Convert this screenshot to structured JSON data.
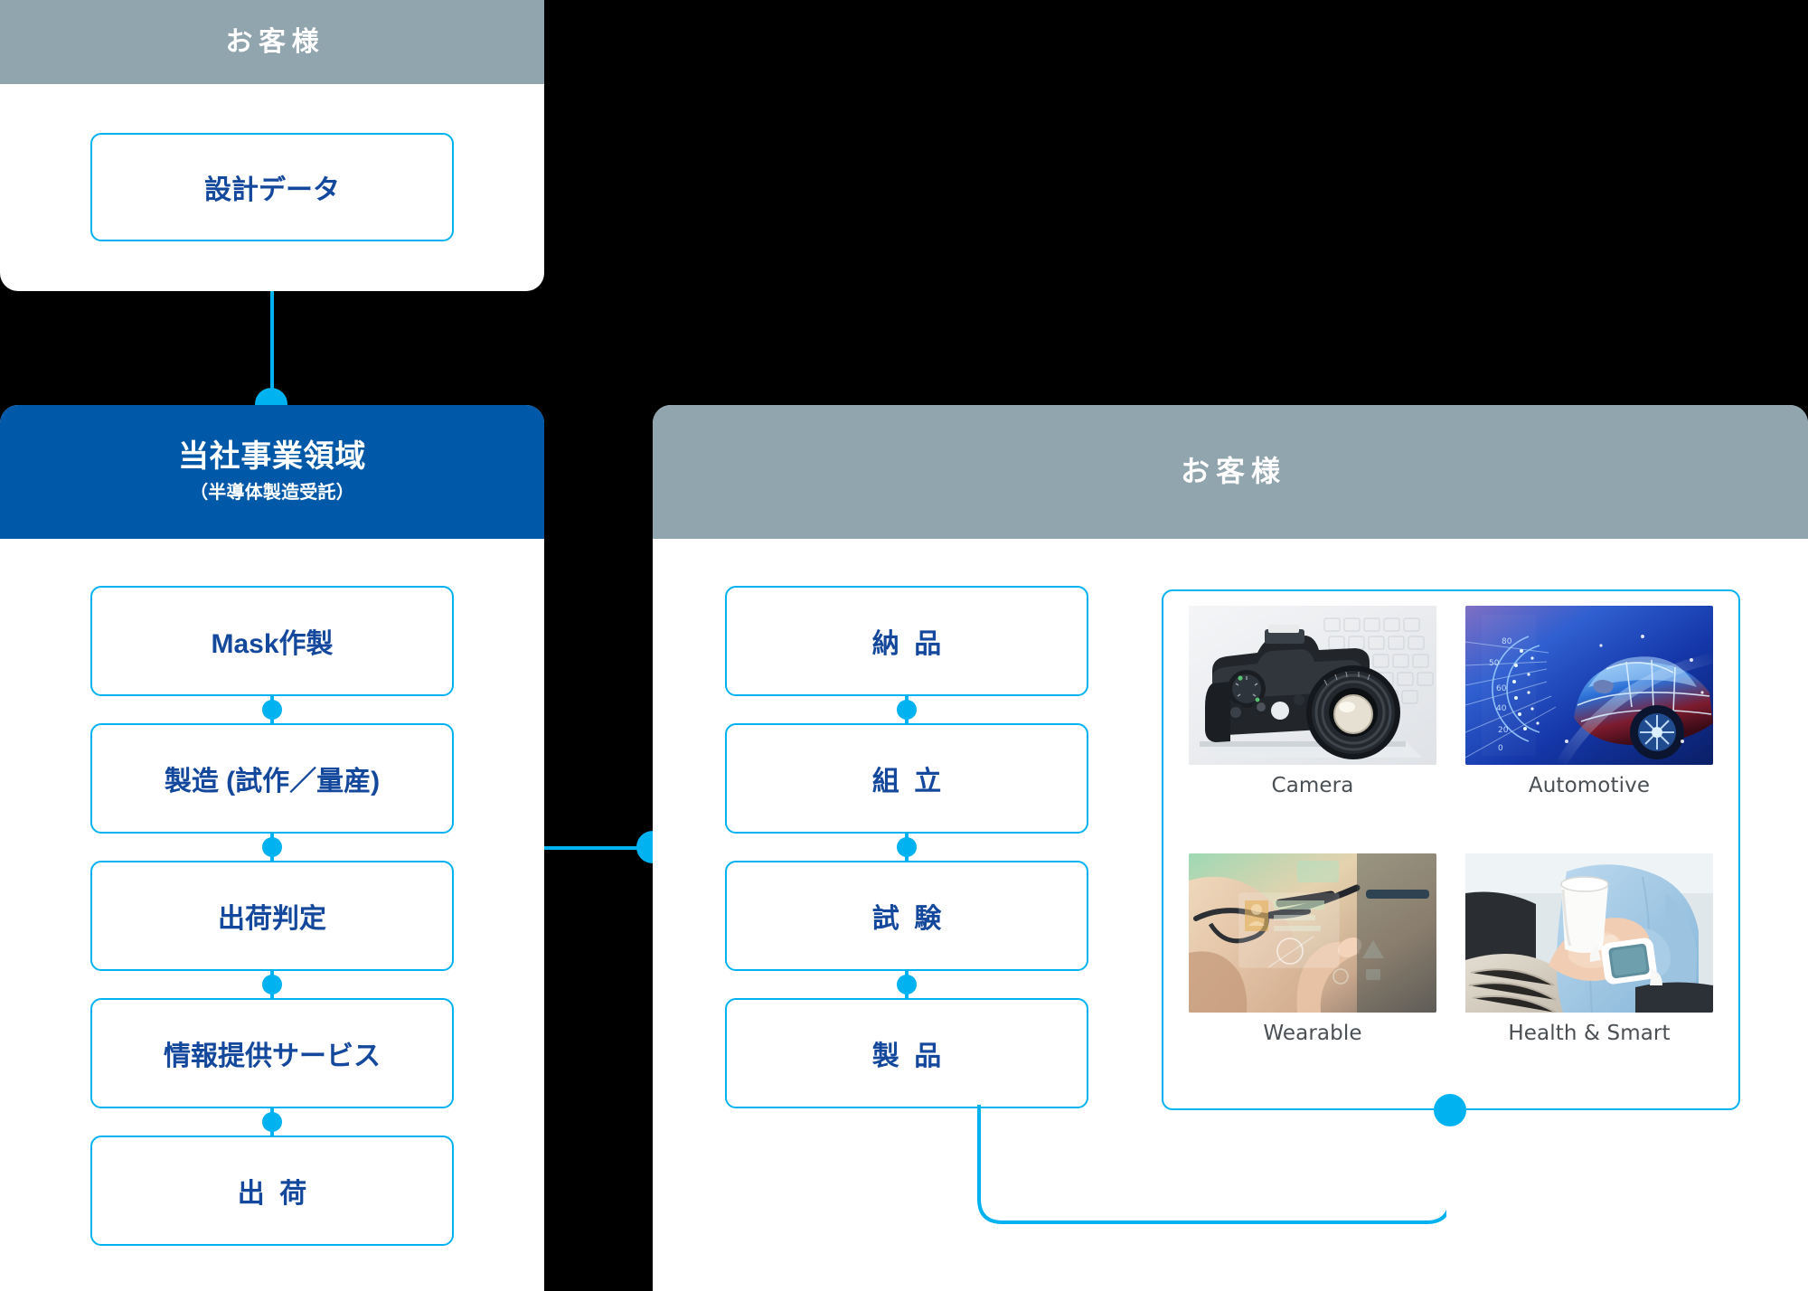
{
  "panels": {
    "customer_top": {
      "title": "お客様"
    },
    "business": {
      "title": "当社事業領域",
      "subtitle": "（半導体製造受託）"
    },
    "customer_right": {
      "title": "お客様"
    }
  },
  "customer_top_flow": [
    {
      "label": "設計データ"
    }
  ],
  "business_flow": [
    {
      "label": "Mask作製",
      "spaced": false
    },
    {
      "label": "製造 (試作／量産)",
      "spaced": false
    },
    {
      "label": "出荷判定",
      "spaced": false
    },
    {
      "label": "情報提供サービス",
      "spaced": false
    },
    {
      "label": "出荷",
      "spaced": true
    }
  ],
  "customer_flow": [
    {
      "label": "納品",
      "spaced": true
    },
    {
      "label": "組立",
      "spaced": true
    },
    {
      "label": "試験",
      "spaced": true
    },
    {
      "label": "製品",
      "spaced": true
    }
  ],
  "product_tiles": [
    {
      "label": "Camera",
      "icon": "camera-photo"
    },
    {
      "label": "Automotive",
      "icon": "automotive-photo"
    },
    {
      "label": "Wearable",
      "icon": "wearable-photo"
    },
    {
      "label": "Health & Smart",
      "icon": "health-smart-photo"
    }
  ],
  "colors": {
    "header_gray": "#91a5ae",
    "header_blue": "#0059a8",
    "accent_cyan": "#00b2ef",
    "text_blue": "#14489c",
    "panel_bg": "#ffffff",
    "page_bg": "#000000",
    "tile_label": "#4a4f54"
  }
}
